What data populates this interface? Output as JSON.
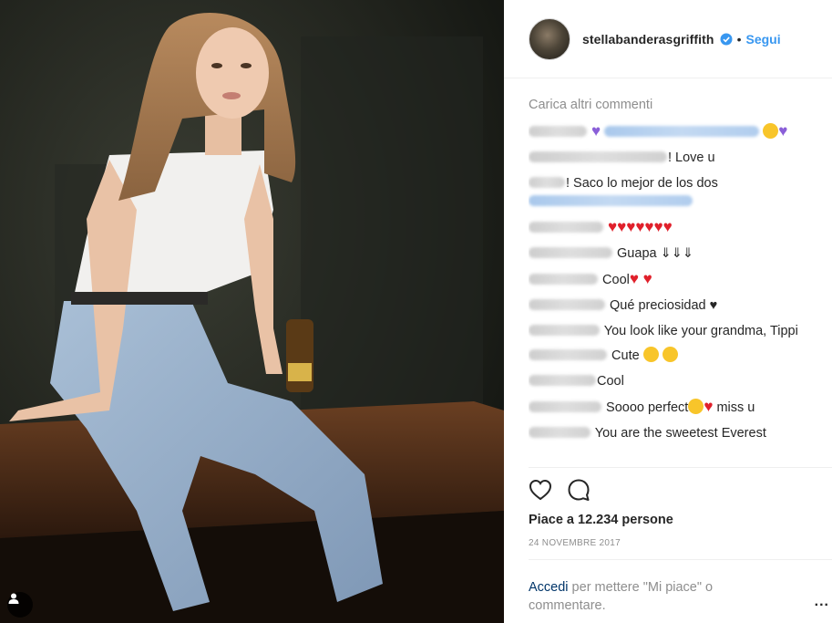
{
  "post": {
    "username": "stellabanderasgriffith",
    "verified_icon": "verified-badge-icon",
    "dot": "•",
    "follow_label": "Segui"
  },
  "comments": {
    "load_more": "Carica altri commenti",
    "items": [
      {
        "text": ""
      },
      {
        "text": "! Love u"
      },
      {
        "text": "! Saco lo mejor de los dos"
      },
      {
        "text": ""
      },
      {
        "text": "Guapa ⇓⇓⇓"
      },
      {
        "text": "Cool"
      },
      {
        "text": "Qué preciosidad ♥"
      },
      {
        "text": "You look like your grandma, Tippi"
      },
      {
        "text": "Cute"
      },
      {
        "text": "Cool"
      },
      {
        "text": "Soooo perfect"
      },
      {
        "text": "miss u"
      },
      {
        "text": "You are the sweetest Everest"
      }
    ]
  },
  "footer": {
    "likes": "Piace a 12.234 persone",
    "date": "24 NOVEMBRE 2017",
    "login_link": "Accedi",
    "login_rest": " per mettere \"Mi piace\" o commentare.",
    "more": "..."
  },
  "colors": {
    "link_blue": "#3897f0",
    "heart_red": "#e0202b",
    "heart_purple": "#8a5fd8"
  }
}
